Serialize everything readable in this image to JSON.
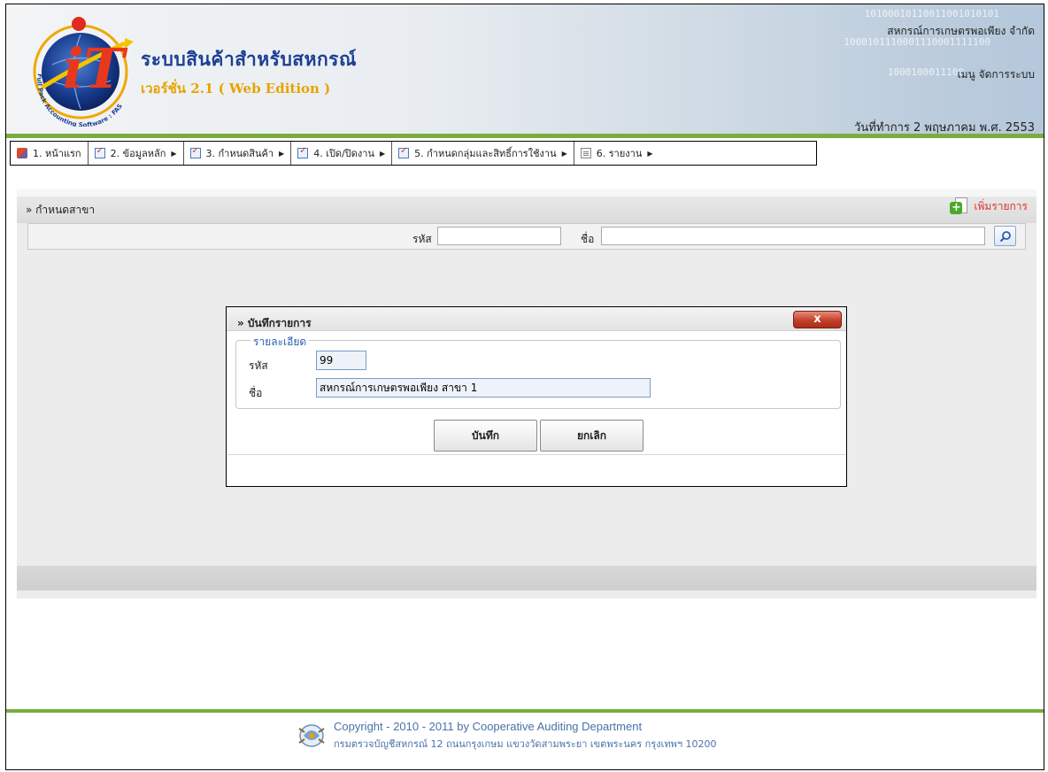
{
  "header": {
    "app_title": "ระบบสินค้าสำหรับสหกรณ์",
    "version": "เวอร์ชั่น 2.1 ( Web Edition )",
    "org_name": "สหกรณ์การเกษตรพอเพียง จำกัด",
    "menu_title": "เมนู จัดการระบบ",
    "work_date": "วันที่ทำการ 2 พฤษภาคม พ.ศ. 2553",
    "logo_letters": "iT",
    "logo_ring_text": "Full Pack Accounting Software : FAS",
    "binary_1": "10100010110011001010101",
    "binary_2": "1000101110001110001111100",
    "binary_3": "1000100011100"
  },
  "menu": {
    "items": [
      {
        "label": "1. หน้าแรก",
        "icon": "home-icon",
        "has_submenu": false
      },
      {
        "label": "2. ข้อมูลหลัก",
        "icon": "checklist-icon",
        "has_submenu": true
      },
      {
        "label": "3. กำหนดสินค้า",
        "icon": "checklist-icon",
        "has_submenu": true
      },
      {
        "label": "4. เปิด/ปิดงาน",
        "icon": "checklist-icon",
        "has_submenu": true
      },
      {
        "label": "5. กำหนดกลุ่มและสิทธิ์การใช้งาน",
        "icon": "checklist-icon",
        "has_submenu": true
      },
      {
        "label": "6. รายงาน",
        "icon": "document-icon",
        "has_submenu": true
      }
    ],
    "submenu_arrow": "▶"
  },
  "panel": {
    "title": "» กำหนดสาขา",
    "add_label": "เพิ่มรายการ",
    "search": {
      "code_label": "รหัส",
      "code_value": "",
      "name_label": "ชื่อ",
      "name_value": ""
    }
  },
  "dialog": {
    "title": "» บันทึกรายการ",
    "close_label": "x",
    "legend": "รายละเอียด",
    "code_label": "รหัส",
    "code_value": "99",
    "name_label": "ชื่อ",
    "name_value": "สหกรณ์การเกษตรพอเพียง สาขา 1",
    "save_label": "บันทึก",
    "cancel_label": "ยกเลิก"
  },
  "footer": {
    "copyright": "Copyright - 2010 - 2011  by Cooperative Auditing Department",
    "address": "กรมตรวจบัญชีสหกรณ์ 12 ถนนกรุงเกษม แขวงวัดสามพระยา เขตพระนคร กรุงเทพฯ 10200"
  },
  "colors": {
    "accent_green": "#7aad3e",
    "title_blue": "#1c3f93",
    "version_orange": "#e8a200",
    "add_red": "#e0302a",
    "legend_blue": "#2a5cb0",
    "close_red": "#c2402a"
  }
}
